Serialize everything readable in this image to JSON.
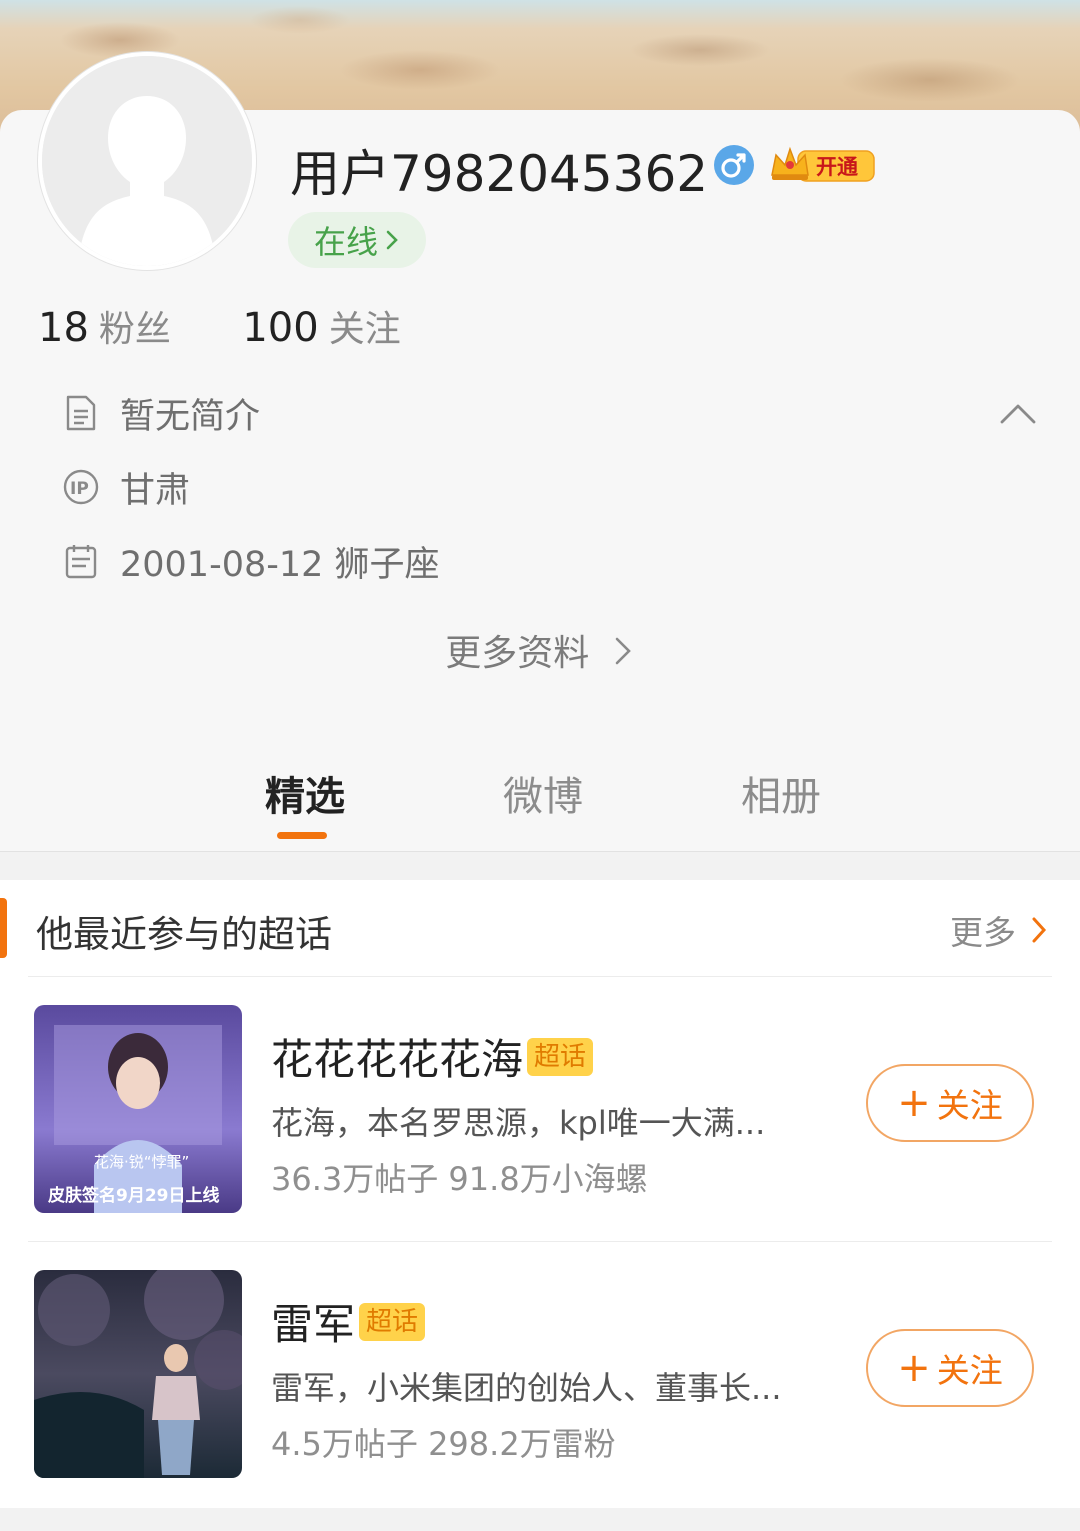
{
  "colors": {
    "accent": "#f2730e",
    "online": "#47a24a",
    "gender": "#5aa7e8",
    "tag": "#ffd24a"
  },
  "profile": {
    "username": "用户7982045362",
    "gender_icon": "male-icon",
    "vip_label": "开通",
    "online_label": "在线",
    "followers_count": "18",
    "followers_label": "粉丝",
    "following_count": "100",
    "following_label": "关注",
    "bio": "暂无简介",
    "ip_location": "甘肃",
    "birthday": "2001-08-12 狮子座",
    "more_info": "更多资料"
  },
  "tabs": [
    {
      "label": "精选",
      "active": true
    },
    {
      "label": "微博",
      "active": false
    },
    {
      "label": "相册",
      "active": false
    }
  ],
  "supertopics": {
    "title": "他最近参与的超话",
    "more_label": "更多",
    "items": [
      {
        "name": "花花花花花海",
        "tag": "超话",
        "desc": "花海，本名罗思源，kpl唯一大满...",
        "stats": "36.3万帖子 91.8万小海螺",
        "follow_label": "关注",
        "image_caption_1": "花海·锐“悖罪”",
        "image_caption_2": "皮肤签名9月29日上线"
      },
      {
        "name": "雷军",
        "tag": "超话",
        "desc": "雷军，小米集团的创始人、董事长...",
        "stats": "4.5万帖子 298.2万雷粉",
        "follow_label": "关注"
      }
    ]
  }
}
